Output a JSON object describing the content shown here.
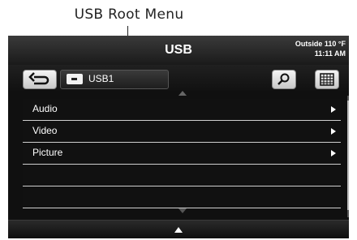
{
  "callout": {
    "label": "USB Root Menu"
  },
  "header": {
    "title": "USB",
    "outside_temp": "Outside 110 °F",
    "time": "11:11 AM"
  },
  "toolbar": {
    "source_label": "USB1"
  },
  "menu": {
    "items": [
      {
        "label": "Audio"
      },
      {
        "label": "Video"
      },
      {
        "label": "Picture"
      },
      {
        "label": ""
      },
      {
        "label": ""
      }
    ]
  },
  "icons": {
    "back": "back-arrow-icon",
    "usb": "usb-drive-icon",
    "search": "search-icon",
    "keypad": "keypad-icon",
    "scroll_up": "chevron-up-icon",
    "scroll_down": "chevron-down-icon"
  }
}
